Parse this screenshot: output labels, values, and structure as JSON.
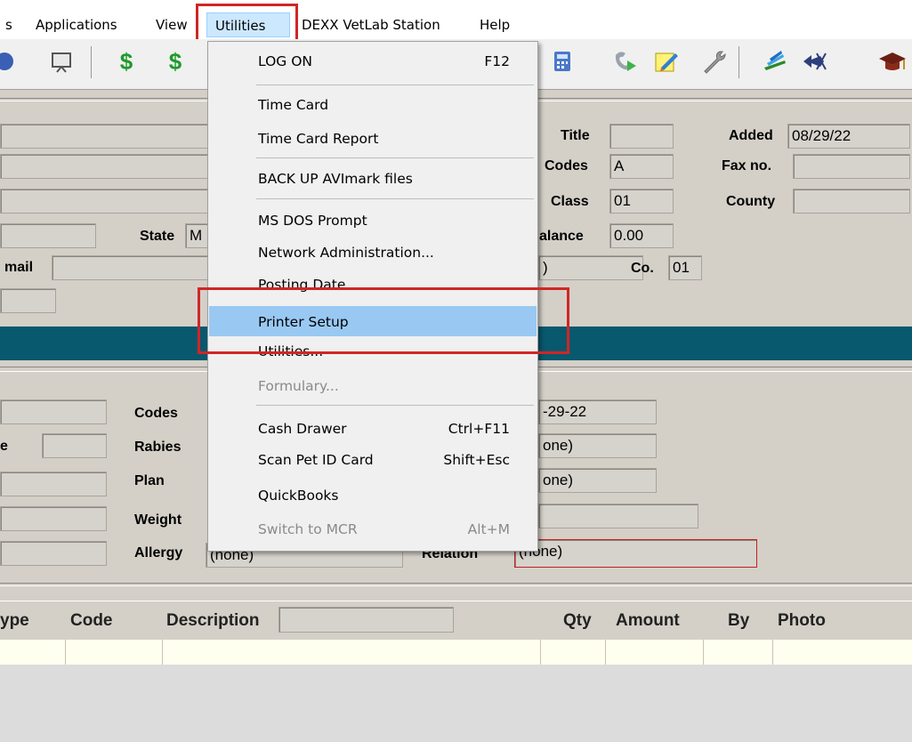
{
  "menubar": {
    "items": [
      "s",
      "Applications",
      "View",
      "Utilities",
      "DEXX VetLab Station",
      "Help"
    ],
    "active": "Utilities"
  },
  "toolbar": {
    "icons": [
      "house-icon",
      "monitor-icon",
      "dollar-icon",
      "dollar-plus-icon",
      "calculator-icon",
      "phone-icon",
      "notepad-icon",
      "wrench-icon",
      "stack-icon",
      "fish-icon",
      "graduation-cap-icon"
    ]
  },
  "client": {
    "title_label": "Title",
    "title_value": "",
    "added_label": "Added",
    "added_value": "08/29/22",
    "codes_label": "Codes",
    "codes_value": "A",
    "fax_label": "Fax no.",
    "fax_value": "",
    "class_label": "Class",
    "class_value": "01",
    "county_label": "County",
    "county_value": "",
    "state_label": "State",
    "state_value": "M",
    "balance_label": "alance",
    "balance_value": "0.00",
    "email_label": "mail",
    "email_value": "",
    "co_label": "Co.",
    "co_value": "01",
    "partial_value": ")"
  },
  "patient": {
    "codes_label": "Codes",
    "age_label": "e",
    "rabies_label": "Rabies",
    "plan_label": "Plan",
    "weight_label": "Weight",
    "allergy_label": "Allergy",
    "allergy_value": "(none)",
    "relation_label": "Relation",
    "relation_value": "(none)",
    "date_value": "-29-22",
    "rabies_value": "one)",
    "plan_value": "one)"
  },
  "table": {
    "headers": [
      "ype",
      "Code",
      "Description",
      "Qty",
      "Amount",
      "By",
      "Photo"
    ]
  },
  "utilities_menu": {
    "items": [
      {
        "label": "LOG ON",
        "shortcut": "F12"
      },
      {
        "label": "Time Card",
        "shortcut": ""
      },
      {
        "label": "Time Card Report",
        "shortcut": ""
      },
      {
        "label": "BACK UP AVImark files",
        "shortcut": ""
      },
      {
        "label": "MS DOS Prompt",
        "shortcut": ""
      },
      {
        "label": "Network Administration...",
        "shortcut": ""
      },
      {
        "label": "Posting Date",
        "shortcut": ""
      },
      {
        "label": "Printer Setup",
        "shortcut": ""
      },
      {
        "label": "Utilities...",
        "shortcut": ""
      },
      {
        "label": "Formulary...",
        "shortcut": ""
      },
      {
        "label": "Cash Drawer",
        "shortcut": "Ctrl+F11"
      },
      {
        "label": "Scan Pet ID Card",
        "shortcut": "Shift+Esc"
      },
      {
        "label": "QuickBooks",
        "shortcut": ""
      },
      {
        "label": "Switch to MCR",
        "shortcut": "Alt+M"
      }
    ],
    "highlighted": "Printer Setup",
    "highlight_color": "#99c9f3",
    "callout_color": "#d02626"
  }
}
